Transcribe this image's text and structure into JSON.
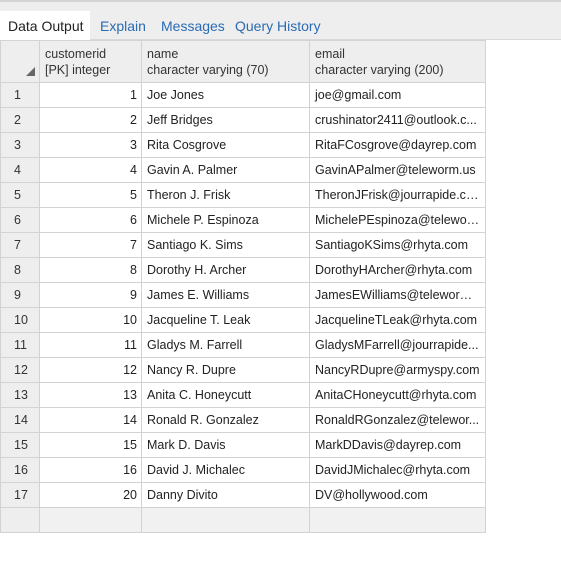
{
  "tabs": [
    {
      "label": "Data Output",
      "active": true
    },
    {
      "label": "Explain",
      "active": false
    },
    {
      "label": "Messages",
      "active": false
    },
    {
      "label": "Query History",
      "active": false
    }
  ],
  "columns": [
    {
      "name": "customerid",
      "type": "[PK] integer"
    },
    {
      "name": "name",
      "type": "character varying (70)"
    },
    {
      "name": "email",
      "type": "character varying (200)"
    }
  ],
  "rows": [
    {
      "n": "1",
      "id": "1",
      "name": "Joe Jones",
      "email": "joe@gmail.com"
    },
    {
      "n": "2",
      "id": "2",
      "name": "Jeff Bridges",
      "email": "crushinator2411@outlook.c..."
    },
    {
      "n": "3",
      "id": "3",
      "name": "Rita Cosgrove",
      "email": "RitaFCosgrove@dayrep.com"
    },
    {
      "n": "4",
      "id": "4",
      "name": "Gavin A. Palmer",
      "email": "GavinAPalmer@teleworm.us"
    },
    {
      "n": "5",
      "id": "5",
      "name": "Theron J. Frisk",
      "email": "TheronJFrisk@jourrapide.com"
    },
    {
      "n": "6",
      "id": "6",
      "name": "Michele P. Espinoza",
      "email": "MichelePEspinoza@telewor..."
    },
    {
      "n": "7",
      "id": "7",
      "name": "Santiago K. Sims",
      "email": "SantiagoKSims@rhyta.com"
    },
    {
      "n": "8",
      "id": "8",
      "name": "Dorothy H. Archer",
      "email": "DorothyHArcher@rhyta.com"
    },
    {
      "n": "9",
      "id": "9",
      "name": "James E. Williams",
      "email": "JamesEWilliams@teleworm...."
    },
    {
      "n": "10",
      "id": "10",
      "name": "Jacqueline T. Leak",
      "email": "JacquelineTLeak@rhyta.com"
    },
    {
      "n": "11",
      "id": "11",
      "name": "Gladys M. Farrell",
      "email": "GladysMFarrell@jourrapide..."
    },
    {
      "n": "12",
      "id": "12",
      "name": "Nancy R. Dupre",
      "email": "NancyRDupre@armyspy.com"
    },
    {
      "n": "13",
      "id": "13",
      "name": "Anita C. Honeycutt",
      "email": "AnitaCHoneycutt@rhyta.com"
    },
    {
      "n": "14",
      "id": "14",
      "name": "Ronald R. Gonzalez",
      "email": "RonaldRGonzalez@telewor..."
    },
    {
      "n": "15",
      "id": "15",
      "name": "Mark D. Davis",
      "email": "MarkDDavis@dayrep.com"
    },
    {
      "n": "16",
      "id": "16",
      "name": "David J. Michalec",
      "email": "DavidJMichalec@rhyta.com"
    },
    {
      "n": "17",
      "id": "20",
      "name": "Danny Divito",
      "email": "DV@hollywood.com"
    }
  ]
}
